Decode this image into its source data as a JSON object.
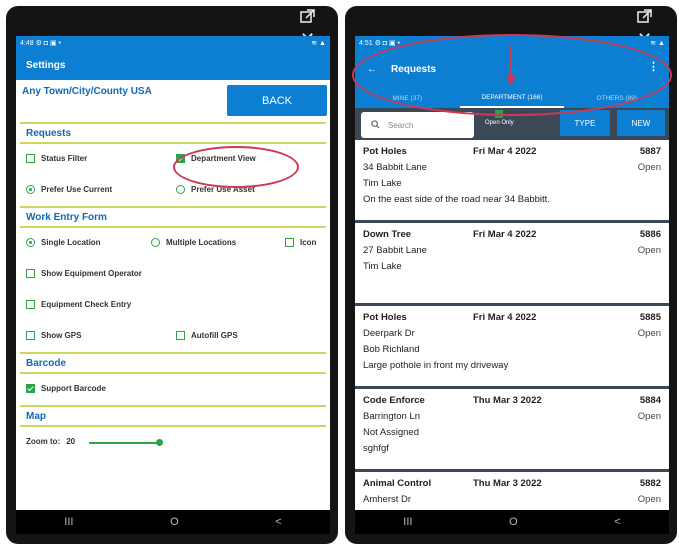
{
  "window_controls": {
    "popout_icon": "external-window-icon",
    "close": "✕"
  },
  "left": {
    "status_time": "4:48",
    "status_icons": "⚙ ◘ ▣ •",
    "status_right": "≋ ▲",
    "appbar_title": "Settings",
    "town": "Any Town/City/County USA",
    "back_label": "BACK",
    "sections": {
      "requests": "Requests",
      "work_entry": "Work Entry Form",
      "barcode": "Barcode",
      "map": "Map"
    },
    "options": {
      "status_filter": "Status Filter",
      "department_view": "Department View",
      "prefer_use_current": "Prefer Use Current",
      "prefer_use_asset": "Prefer Use Asset",
      "single_location": "Single Location",
      "multiple_locations": "Multiple Locations",
      "icon": "Icon",
      "show_equipment_operator": "Show Equipment Operator",
      "equipment_check_entry": "Equipment Check Entry",
      "show_gps": "Show GPS",
      "autofill_gps": "Autofill GPS",
      "support_barcode": "Support Barcode",
      "zoom_label": "Zoom to:",
      "zoom_value": "20"
    },
    "nav": {
      "recent": "III",
      "home": "O",
      "back": "<"
    }
  },
  "right": {
    "status_time": "4:51",
    "status_icons": "⚙ ◘ ▣ •",
    "status_right": "≋ ▲",
    "title": "Requests",
    "tabs": [
      "MINE (37)",
      "DEPARTMENT (166)",
      "OTHERS (89)"
    ],
    "search_placeholder": "Search",
    "open_only": "Open Only",
    "type_label": "TYPE",
    "new_label": "NEW",
    "requests": [
      {
        "type": "Pot Holes",
        "date": "Fri Mar 4 2022",
        "num": "5887",
        "status": "Open",
        "l1": "34 Babbit Lane",
        "l2": "Tim Lake",
        "l3": "On the east side of the road near 34 Babbitt."
      },
      {
        "type": "Down Tree",
        "date": "Fri Mar 4 2022",
        "num": "5886",
        "status": "Open",
        "l1": "27 Babbit Lane",
        "l2": "Tim Lake",
        "l3": ""
      },
      {
        "type": "Pot Holes",
        "date": "Fri Mar 4 2022",
        "num": "5885",
        "status": "Open",
        "l1": "Deerpark Dr",
        "l2": "Bob Richland",
        "l3": "Large pothole in front my driveway"
      },
      {
        "type": "Code Enforce",
        "date": "Thu Mar 3 2022",
        "num": "5884",
        "status": "Open",
        "l1": "Barrington Ln",
        "l2": "Not Assigned",
        "l3": "sghfgf"
      },
      {
        "type": "Animal Control",
        "date": "Thu Mar 3 2022",
        "num": "5882",
        "status": "Open",
        "l1": "Amherst Dr",
        "l2": "",
        "l3": ""
      }
    ],
    "nav": {
      "recent": "III",
      "home": "O",
      "back": "<"
    }
  },
  "colors": {
    "primary": "#0c7fd3",
    "accent_green": "#2aa34a",
    "annotation": "#cc3a55",
    "divider": "#c9d85c"
  }
}
